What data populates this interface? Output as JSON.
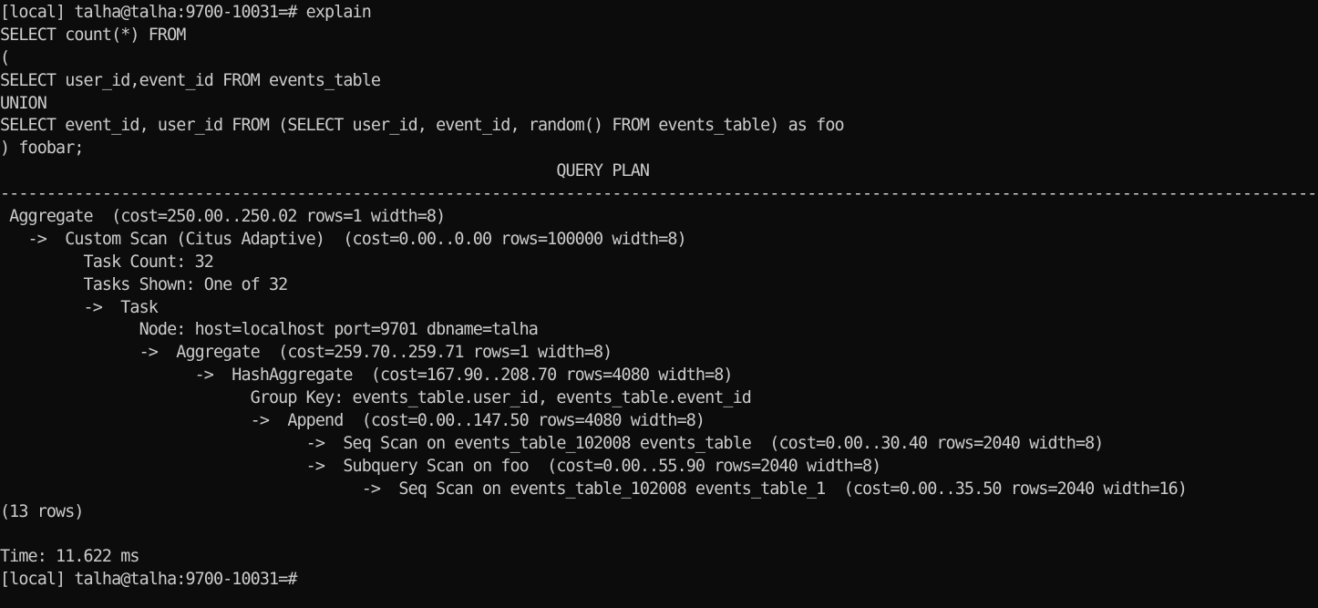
{
  "terminal": {
    "lines": [
      "[local] talha@talha:9700-10031=# explain",
      "SELECT count(*) FROM",
      "(",
      "SELECT user_id,event_id FROM events_table",
      "UNION",
      "SELECT event_id, user_id FROM (SELECT user_id, event_id, random() FROM events_table) as foo",
      ") foobar;",
      "                                                            QUERY PLAN",
      "-----------------------------------------------------------------------------------------------------------------------------------------------",
      " Aggregate  (cost=250.00..250.02 rows=1 width=8)",
      "   ->  Custom Scan (Citus Adaptive)  (cost=0.00..0.00 rows=100000 width=8)",
      "         Task Count: 32",
      "         Tasks Shown: One of 32",
      "         ->  Task",
      "               Node: host=localhost port=9701 dbname=talha",
      "               ->  Aggregate  (cost=259.70..259.71 rows=1 width=8)",
      "                     ->  HashAggregate  (cost=167.90..208.70 rows=4080 width=8)",
      "                           Group Key: events_table.user_id, events_table.event_id",
      "                           ->  Append  (cost=0.00..147.50 rows=4080 width=8)",
      "                                 ->  Seq Scan on events_table_102008 events_table  (cost=0.00..30.40 rows=2040 width=8)",
      "                                 ->  Subquery Scan on foo  (cost=0.00..55.90 rows=2040 width=8)",
      "                                       ->  Seq Scan on events_table_102008 events_table_1  (cost=0.00..35.50 rows=2040 width=16)",
      "(13 rows)",
      "",
      "Time: 11.622 ms",
      "[local] talha@talha:9700-10031=# "
    ]
  }
}
